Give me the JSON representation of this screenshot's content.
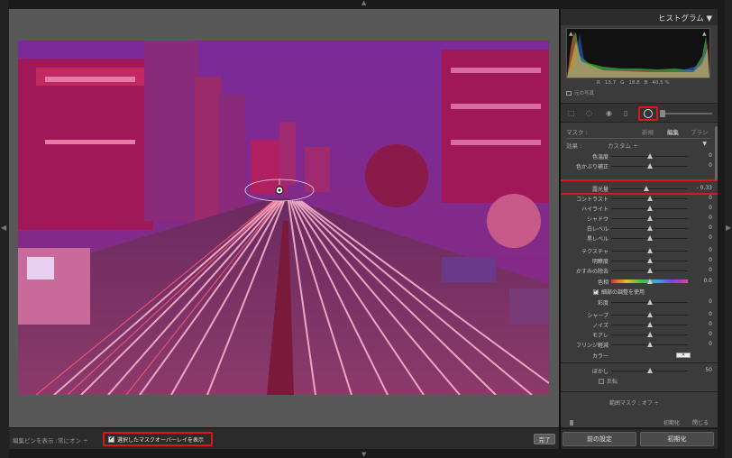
{
  "histogram": {
    "title": "ヒストグラム ▼",
    "readout": {
      "r_label": "R",
      "r_value": "13.7",
      "g_label": "G",
      "g_value": "18.8",
      "b_label": "B",
      "b_value": "40.5 %"
    },
    "original_photo_label": "元の写真"
  },
  "mask_header": {
    "label": "マスク :",
    "tabs": [
      "新規",
      "編集",
      "ブラシ"
    ],
    "active_tab": "編集"
  },
  "effect": {
    "label": "効果 :",
    "value": "カスタム ÷"
  },
  "sliders": [
    {
      "label": "色温度",
      "value": "0",
      "pos": 0.5
    },
    {
      "label": "色かぶり補正",
      "value": "0",
      "pos": 0.5
    },
    {
      "label": "露光量",
      "value": "- 0.33",
      "pos": 0.46
    },
    {
      "label": "コントラスト",
      "value": "0",
      "pos": 0.5
    },
    {
      "label": "ハイライト",
      "value": "0",
      "pos": 0.5
    },
    {
      "label": "シャドウ",
      "value": "0",
      "pos": 0.5
    },
    {
      "label": "白レベル",
      "value": "0",
      "pos": 0.5
    },
    {
      "label": "黒レベル",
      "value": "0",
      "pos": 0.5
    },
    {
      "label": "テクスチャ",
      "value": "0",
      "pos": 0.5
    },
    {
      "label": "明瞭度",
      "value": "0",
      "pos": 0.5
    },
    {
      "label": "かすみの除去",
      "value": "0",
      "pos": 0.5
    }
  ],
  "color_slider": {
    "label": "色相",
    "value": "0.0"
  },
  "fine_adjust": {
    "label": "細部の調整を使用",
    "checked": true
  },
  "saturation": {
    "label": "彩度",
    "value": "0",
    "pos": 0.5
  },
  "detail_sliders": [
    {
      "label": "シャープ",
      "value": "0",
      "pos": 0.5
    },
    {
      "label": "ノイズ",
      "value": "0",
      "pos": 0.5
    },
    {
      "label": "モアレ",
      "value": "0",
      "pos": 0.5
    },
    {
      "label": "フリンジ軽減",
      "value": "0",
      "pos": 0.5
    }
  ],
  "color_row": {
    "label": "カラー",
    "swatch": "✕"
  },
  "feather": {
    "label": "ぼかし",
    "value": "50",
    "pos": 0.5
  },
  "invert": {
    "label": "反転"
  },
  "range_mask": {
    "label": "範囲マスク : オフ ÷"
  },
  "range_row": {
    "reset": "初期化",
    "close": "閉じる"
  },
  "bottom_buttons": {
    "previous": "前の設定",
    "reset": "初期化"
  },
  "toolbar": {
    "pins_label": "編集ピンを表示 :",
    "pins_value": "常にオン ÷",
    "overlay_label": "選択したマスクオーバーレイを表示",
    "overlay_checked": true,
    "done": "完了"
  },
  "colors": {
    "accent_highlight": "#e01414",
    "mask_overlay": "#b3205a",
    "panel_bg": "#3b3b3b"
  }
}
